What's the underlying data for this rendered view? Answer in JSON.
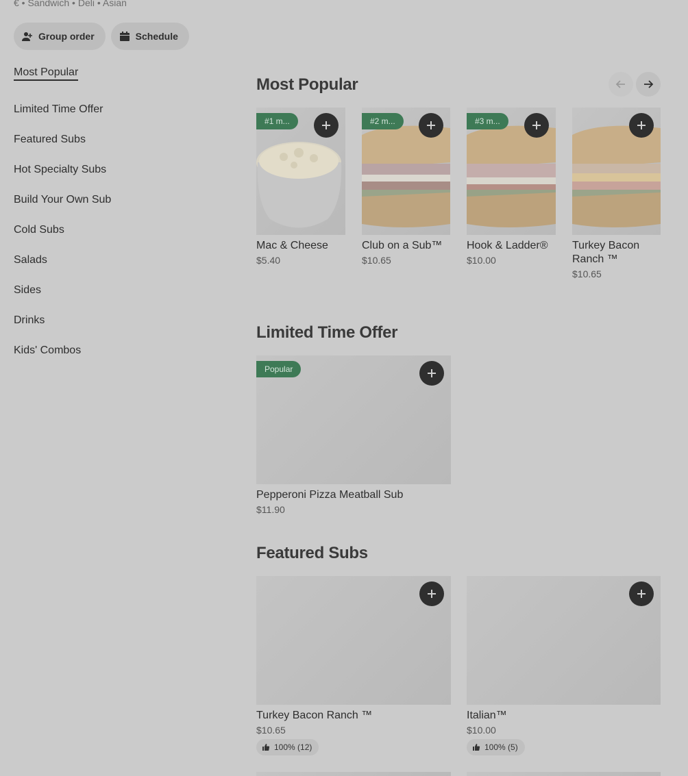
{
  "store": {
    "meta": "€ • Sandwich • Deli • Asian"
  },
  "actions": {
    "group_order": "Group order",
    "schedule": "Schedule"
  },
  "sidebar": {
    "items": [
      {
        "label": "Most Popular",
        "active": true
      },
      {
        "label": "Limited Time Offer"
      },
      {
        "label": "Featured Subs"
      },
      {
        "label": "Hot Specialty Subs"
      },
      {
        "label": "Build Your Own Sub"
      },
      {
        "label": "Cold Subs"
      },
      {
        "label": "Salads"
      },
      {
        "label": "Sides"
      },
      {
        "label": "Drinks"
      },
      {
        "label": "Kids' Combos"
      }
    ]
  },
  "most_popular": {
    "title": "Most Popular",
    "items": [
      {
        "badge": "#1 m...",
        "name": "Mac & Cheese",
        "price": "$5.40",
        "icon": "mac-and-cheese-image"
      },
      {
        "badge": "#2 m...",
        "name": "Club on a Sub™",
        "price": "$10.65",
        "icon": "club-sub-image"
      },
      {
        "badge": "#3 m...",
        "name": "Hook & Ladder®",
        "price": "$10.00",
        "icon": "hook-ladder-sub-image"
      },
      {
        "badge": "",
        "name": "Turkey Bacon Ranch ™",
        "price": "$10.65",
        "icon": "turkey-bacon-ranch-sub-image"
      }
    ]
  },
  "limited_time": {
    "title": "Limited Time Offer",
    "items": [
      {
        "badge": "Popular",
        "name": "Pepperoni Pizza Meatball Sub",
        "price": "$11.90"
      }
    ]
  },
  "featured": {
    "title": "Featured Subs",
    "items": [
      {
        "name": "Turkey Bacon Ranch ™",
        "price": "$10.65",
        "rating": "100% (12)"
      },
      {
        "name": "Italian™",
        "price": "$10.00",
        "rating": "100% (5)"
      }
    ]
  },
  "colors": {
    "badge_green": "#3e7a56",
    "overlay_gray": "#cbcbcb",
    "add_button": "#2f2f2f"
  }
}
